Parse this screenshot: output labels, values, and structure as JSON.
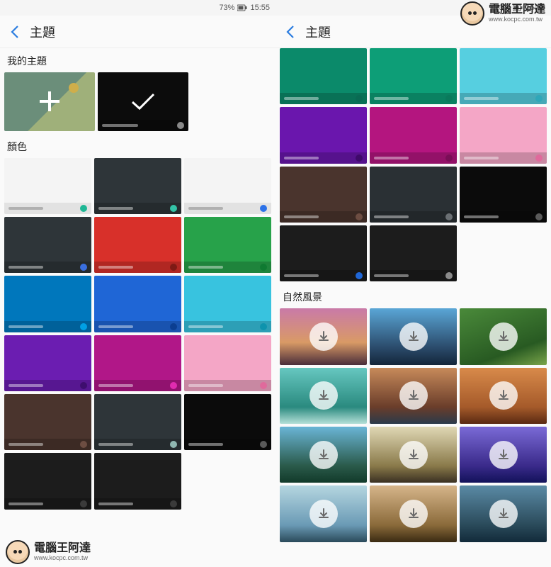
{
  "status": {
    "battery": "73%",
    "time": "15:55"
  },
  "header": {
    "title": "主題"
  },
  "watermark": {
    "name": "電腦王阿達",
    "url": "www.kocpc.com.tw"
  },
  "left": {
    "sections": {
      "my_themes": {
        "label": "我的主題"
      },
      "colors": {
        "label": "顏色"
      }
    },
    "color_tiles": [
      {
        "bg": "#f4f4f4",
        "accent": "#1fb795",
        "light": true
      },
      {
        "bg": "#2e3539",
        "accent": "#33c2a6",
        "light": false
      },
      {
        "bg": "#f4f4f4",
        "accent": "#2d72e8",
        "light": true
      },
      {
        "bg": "#2e3539",
        "accent": "#3a6fe0",
        "light": false
      },
      {
        "bg": "#d8302a",
        "accent": "#7e1a15",
        "light": false
      },
      {
        "bg": "#27a24a",
        "accent": "#0f7a31",
        "light": false
      },
      {
        "bg": "#0077bc",
        "accent": "#00a0e4",
        "light": false
      },
      {
        "bg": "#1f66d6",
        "accent": "#0b3e91",
        "light": false
      },
      {
        "bg": "#38c3df",
        "accent": "#0e93ad",
        "light": false
      },
      {
        "bg": "#6b1db1",
        "accent": "#3e0e6e",
        "light": false
      },
      {
        "bg": "#b11788",
        "accent": "#e02bb0",
        "light": false
      },
      {
        "bg": "#f4a6c6",
        "accent": "#e06a9c",
        "light": false
      },
      {
        "bg": "#4a342d",
        "accent": "#6d4d42",
        "light": false
      },
      {
        "bg": "#2e3539",
        "accent": "#8fb7b1",
        "light": false
      },
      {
        "bg": "#0b0b0b",
        "accent": "#5a5a5a",
        "light": false
      },
      {
        "bg": "#1c1c1c",
        "accent": "#3a3a3a",
        "light": false
      },
      {
        "bg": "#1c1c1c",
        "accent": "#3a3a3a",
        "light": false
      }
    ]
  },
  "right": {
    "sections": {
      "landscape": {
        "label": "自然風景"
      }
    },
    "top_tiles": [
      {
        "bg": "#0b8a6a",
        "accent": "#0a6a53"
      },
      {
        "bg": "#0d9e77",
        "accent": "#0a7a5c"
      },
      {
        "bg": "#56cfe0",
        "accent": "#2fa7b9"
      },
      {
        "bg": "#6a16ad",
        "accent": "#3f0a6b"
      },
      {
        "bg": "#b4157f",
        "accent": "#7a0e57"
      },
      {
        "bg": "#f4a6c6",
        "accent": "#e06a9c"
      },
      {
        "bg": "#4a342d",
        "accent": "#6d4d42"
      },
      {
        "bg": "#2a3034",
        "accent": "#6a6f73"
      },
      {
        "bg": "#0b0b0b",
        "accent": "#5a5a5a"
      },
      {
        "bg": "#1c1c1c",
        "accent": "#1f66d6"
      },
      {
        "bg": "#1c1c1c",
        "accent": "#8a8a8a"
      }
    ],
    "landscape_tiles": [
      {
        "grad": "linear-gradient(180deg,#c97aa8,#d99a66 60%,#4a2d3a)"
      },
      {
        "grad": "linear-gradient(180deg,#5aa6d6,#2a4a6a 70%,#13263a)"
      },
      {
        "grad": "linear-gradient(160deg,#4a8a3a,#285a22 70%,#7aa54a)"
      },
      {
        "grad": "linear-gradient(180deg,#66c7c0,#2a8a7f 70%,#b5e0d8)"
      },
      {
        "grad": "linear-gradient(180deg,#c78a5a,#6a3d2a 70%,#2a3a4a)"
      },
      {
        "grad": "linear-gradient(180deg,#d88a4a,#a55a2a 70%,#5a2a12)"
      },
      {
        "grad": "linear-gradient(180deg,#6ab5d6,#2a5a4a 70%,#123a2a)"
      },
      {
        "grad": "linear-gradient(180deg,#e0d8b5,#8a7a4a 70%,#3a3022)"
      },
      {
        "grad": "linear-gradient(180deg,#7a6ad6,#3a2a8a 70%,#12125a)"
      },
      {
        "grad": "linear-gradient(180deg,#b5d6e0,#6a9ab5 70%,#2a4a5a)"
      },
      {
        "grad": "linear-gradient(180deg,#d6b58a,#8a6a3a 70%,#3a2a12)"
      },
      {
        "grad": "linear-gradient(180deg,#5a8aa5,#2a4a5a 70%,#122a3a)"
      }
    ]
  }
}
